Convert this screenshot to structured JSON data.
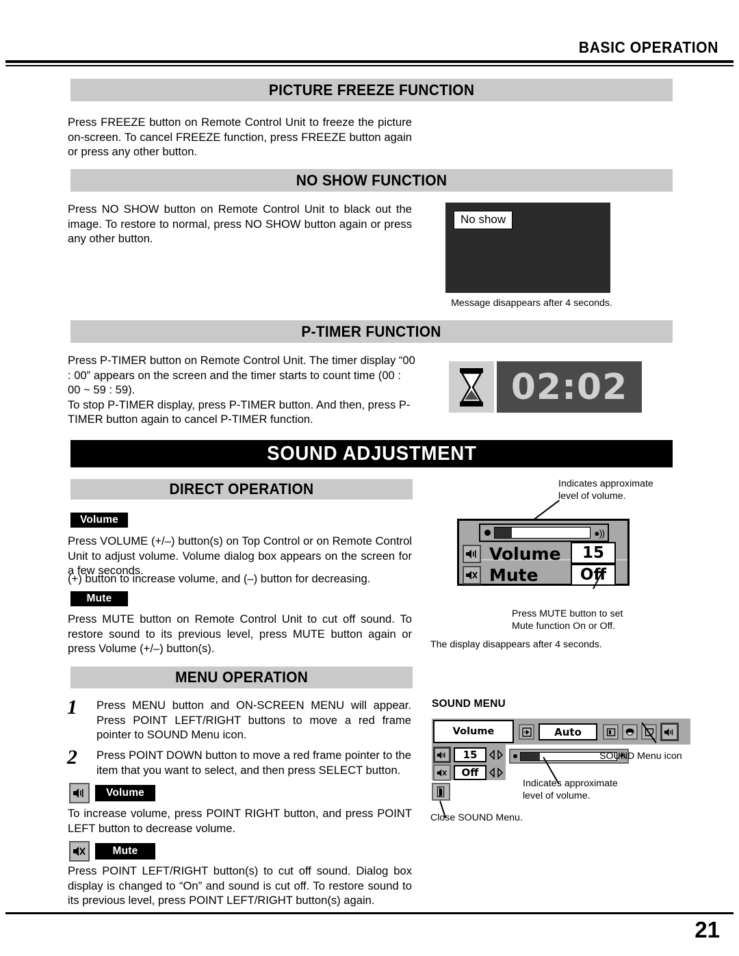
{
  "header": {
    "title": "BASIC OPERATION"
  },
  "sections": {
    "picture_freeze": {
      "bar_title": "PICTURE FREEZE FUNCTION",
      "body": "Press FREEZE button on Remote Control Unit to freeze the picture on-screen.  To cancel FREEZE function, press FREEZE button again or press any other button."
    },
    "no_show": {
      "bar_title": "NO SHOW FUNCTION",
      "body": "Press NO SHOW button on Remote Control Unit to black out the image.  To restore to normal, press NO SHOW button again or press any other button.",
      "screen_label": "No show",
      "caption": "Message disappears after 4 seconds."
    },
    "p_timer": {
      "bar_title": "P-TIMER FUNCTION",
      "body": "Press P-TIMER button on Remote Control Unit.  The timer display “00 : 00” appears on the screen and the timer starts to count time (00 : 00 ~ 59 : 59).\nTo stop P-TIMER display, press P-TIMER button.  And then, press P-TIMER button again to cancel P-TIMER function.",
      "timer_value": "02:02",
      "hourglass_icon": "hourglass-icon"
    }
  },
  "sound_adjustment": {
    "banner_title": "SOUND ADJUSTMENT",
    "direct_operation": {
      "bar_title": "DIRECT OPERATION",
      "volume_tag": "Volume",
      "volume_body": "Press VOLUME (+/–) button(s) on Top Control or on Remote Control Unit to adjust volume.  Volume dialog box appears on the screen for a few seconds.",
      "volume_body2": "(+) button to increase volume, and (–) button for decreasing.",
      "mute_tag": "Mute",
      "mute_body": "Press MUTE button on Remote Control Unit to cut off sound.  To restore sound to its previous level, press MUTE button again or press Volume (+/–) button(s)."
    },
    "osd_dialog": {
      "volume_label": "Volume",
      "volume_value": "15",
      "mute_label": "Mute",
      "mute_value": "Off",
      "volume_icon": "speaker-icon",
      "mute_icon": "speaker-mute-icon",
      "gauge_fill_percent": 18
    },
    "annotations": {
      "level_note": "Indicates approximate\nlevel of volume.",
      "level_note_line1": "Indicates approximate",
      "level_note_line2": "level of volume.",
      "mute_note_line1": "Press MUTE button to set",
      "mute_note_line2": "Mute function On or Off.",
      "display_note": "The display disappears after 4 seconds."
    },
    "menu_operation": {
      "bar_title": "MENU OPERATION",
      "steps": [
        {
          "num": "1",
          "text": "Press MENU button and ON-SCREEN MENU will appear.  Press POINT LEFT/RIGHT buttons to move a red frame pointer to SOUND Menu icon."
        },
        {
          "num": "2",
          "text": "Press POINT DOWN button to move a red frame pointer to the item that you want to select, and then press SELECT button."
        }
      ],
      "volume_tag": "Volume",
      "volume_body": "To increase volume, press POINT RIGHT button, and press POINT LEFT button to decrease volume.",
      "mute_tag": "Mute",
      "mute_body": "Press POINT LEFT/RIGHT button(s) to cut off sound.  Dialog box display is changed to “On” and sound is cut off.  To restore sound to its previous level, press POINT LEFT/RIGHT button(s) again."
    },
    "sound_menu": {
      "heading": "SOUND MENU",
      "title_box": "Volume",
      "auto_box": "Auto",
      "volume_value": "15",
      "mute_value": "Off",
      "gauge_fill_percent": 20,
      "icons": [
        "input-icon",
        "screen-icon",
        "image-icon",
        "pc-adjust-icon",
        "sound-icon"
      ],
      "annotations": {
        "sound_menu_icon": "SOUND Menu icon",
        "level_line1": "Indicates approximate",
        "level_line2": "level of volume.",
        "close_note": "Close SOUND Menu."
      }
    }
  },
  "footer": {
    "page_number": "21"
  },
  "colors": {
    "bar_gray": "#c9c9c9",
    "osd_gray": "#a8a8a8",
    "screen_black": "#2b2b2b",
    "timer_bg": "#4a4a4a",
    "timer_fg": "#d0d0d0"
  }
}
